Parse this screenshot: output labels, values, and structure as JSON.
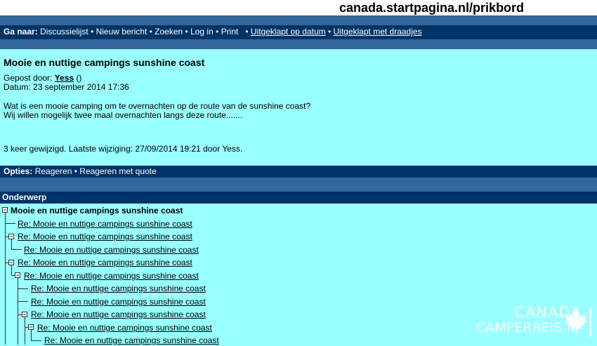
{
  "site": {
    "title": "canada.startpagina.nl/prikbord"
  },
  "nav": {
    "label": "Ga naar:",
    "items": [
      "Discussielijst",
      "Nieuw bericht",
      "Zoeken",
      "Log in",
      "Print"
    ],
    "links": [
      "Uitgeklapt op datum",
      "Uitgeklapt met draadjes"
    ]
  },
  "message": {
    "title": "Mooie en nuttige campings sunshine coast",
    "posted_by_label": "Gepost door:",
    "author": "Yess",
    "author_suffix": "()",
    "date_label": "Datum:",
    "date": "23 september 2014 17:36",
    "body_line1": "Wat is een mooie camping om te overnachten op de route van de sunshine coast?",
    "body_line2": "Wij willen mogelijk twee maal overnachten langs deze route.......",
    "edit_note": "3 keer gewijzigd. Laatste wijziging: 27/09/2014 19:21 door Yess."
  },
  "options": {
    "label": "Opties:",
    "items": [
      "Reageren",
      "Reageren met quote"
    ]
  },
  "thread": {
    "header": "Onderwerp",
    "items": [
      {
        "subject": "Mooie en nuttige campings sunshine coast"
      },
      {
        "subject": "Re: Mooie en nuttige campings sunshine coast"
      },
      {
        "subject": "Re: Mooie en nuttige campings sunshine coast"
      },
      {
        "subject": "Re: Mooie en nuttige campings sunshine coast"
      },
      {
        "subject": "Re: Mooie en nuttige campings sunshine coast"
      },
      {
        "subject": "Re: Mooie en nuttige campings sunshine coast"
      },
      {
        "subject": "Re: Mooie en nuttige campings sunshine coast"
      },
      {
        "subject": "Re: Mooie en nuttige campings sunshine coast"
      },
      {
        "subject": "Re: Mooie en nuttige campings sunshine coast"
      },
      {
        "subject": "Re: Mooie en nuttige campings sunshine coast"
      },
      {
        "subject": "Re: Mooie en nuttige campings sunshine coast"
      }
    ]
  },
  "watermark": {
    "line1": "CANADA",
    "line2": "CAMPERREIS.nl"
  },
  "colors": {
    "background": "#99ffff",
    "bar": "#003366",
    "band": "#336699"
  }
}
